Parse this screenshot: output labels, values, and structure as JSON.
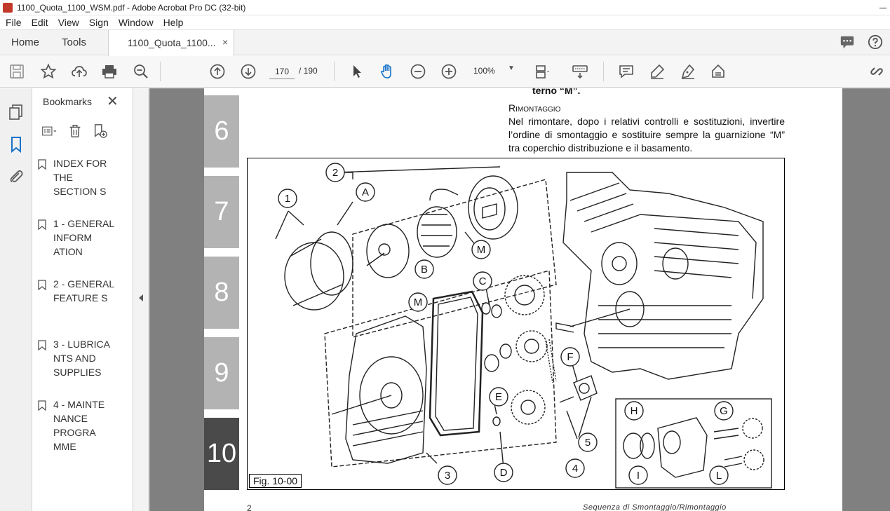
{
  "window": {
    "title": "1100_Quota_1100_WSM.pdf - Adobe Acrobat Pro DC (32-bit)"
  },
  "menu": [
    "File",
    "Edit",
    "View",
    "Sign",
    "Window",
    "Help"
  ],
  "tabs": {
    "home": "Home",
    "tools": "Tools",
    "document": "1100_Quota_1100...",
    "close": "×"
  },
  "toolbar": {
    "current_page": "170",
    "total_pages": "/ 190",
    "zoom": "100%"
  },
  "bookmarks": {
    "header": "Bookmarks",
    "close": "✕",
    "items": [
      {
        "label": "INDEX FOR THE SECTION S"
      },
      {
        "label": "1 - GENERAL INFORM ATION"
      },
      {
        "label": "2 - GENERAL FEATURE S"
      },
      {
        "label": "3 - LUBRICA NTS AND SUPPLIES"
      },
      {
        "label": "4 - MAINTE NANCE PROGRA MME"
      }
    ]
  },
  "page": {
    "chapter_tabs": [
      "6",
      "7",
      "8",
      "9",
      "10"
    ],
    "active_chapter": "10",
    "cut_text": "terno “M”.",
    "subheading": "Rimontaggio",
    "paragraph": "Nel rimontare, dopo i relativi controlli e sostituzioni, invertire l’ordine di smontaggio e sostituire sempre la guarnizione “M” tra coperchio distribuzione e il basamento.",
    "figure_label": "Fig. 10-00",
    "callouts": [
      "1",
      "2",
      "A",
      "B",
      "M",
      "M",
      "C",
      "F",
      "E",
      "D",
      "3",
      "4",
      "5",
      "H",
      "G",
      "I",
      "L"
    ],
    "page_number": "2",
    "footer": "Sequenza di Smontaggio/Rimontaggio"
  },
  "colors": {
    "chapter_tab": "#b3b3b3",
    "chapter_tab_active": "#4a4a4a",
    "doc_background": "#808080",
    "accent_blue": "#1a73c8"
  }
}
